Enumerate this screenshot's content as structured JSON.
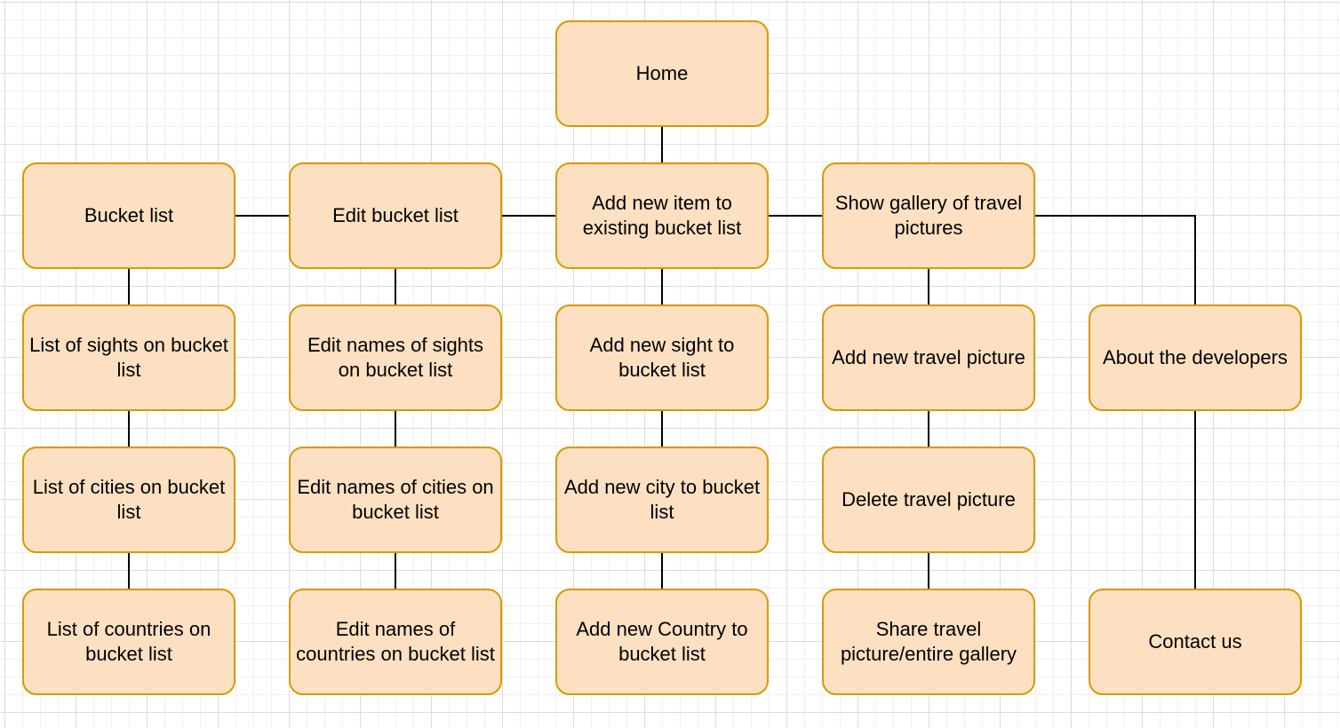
{
  "colors": {
    "node_fill": "#fde0c2",
    "node_border": "#d79b00",
    "edge": "#000000"
  },
  "nodes": {
    "home": "Home",
    "bucket_list": "Bucket list",
    "edit_bucket_list": "Edit bucket list",
    "add_new_item": "Add new item to existing bucket list",
    "show_gallery": "Show gallery of travel pictures",
    "list_sights": "List of sights on bucket list",
    "edit_names_sights": "Edit names of sights on bucket list",
    "add_new_sight": "Add new sight to bucket list",
    "add_new_travel_picture": "Add new travel picture",
    "about_developers": "About the developers",
    "list_cities": "List of cities on bucket list",
    "edit_names_cities": "Edit names of cities on bucket list",
    "add_new_city": "Add new city to bucket list",
    "delete_travel_picture": "Delete travel picture",
    "list_countries": "List of countries on bucket list",
    "edit_names_countries": "Edit names of countries on bucket list",
    "add_new_country": "Add new Country to bucket list",
    "share_travel_picture": "Share travel picture/entire gallery",
    "contact_us": "Contact us"
  },
  "edges": [
    [
      "home",
      "add_new_item"
    ],
    [
      "bucket_list",
      "edit_bucket_list"
    ],
    [
      "edit_bucket_list",
      "add_new_item"
    ],
    [
      "add_new_item",
      "show_gallery"
    ],
    [
      "show_gallery",
      "about_developers"
    ],
    [
      "bucket_list",
      "list_sights"
    ],
    [
      "list_sights",
      "list_cities"
    ],
    [
      "list_cities",
      "list_countries"
    ],
    [
      "edit_bucket_list",
      "edit_names_sights"
    ],
    [
      "edit_names_sights",
      "edit_names_cities"
    ],
    [
      "edit_names_cities",
      "edit_names_countries"
    ],
    [
      "add_new_item",
      "add_new_sight"
    ],
    [
      "add_new_sight",
      "add_new_city"
    ],
    [
      "add_new_city",
      "add_new_country"
    ],
    [
      "show_gallery",
      "add_new_travel_picture"
    ],
    [
      "add_new_travel_picture",
      "delete_travel_picture"
    ],
    [
      "delete_travel_picture",
      "share_travel_picture"
    ],
    [
      "about_developers",
      "contact_us"
    ]
  ]
}
